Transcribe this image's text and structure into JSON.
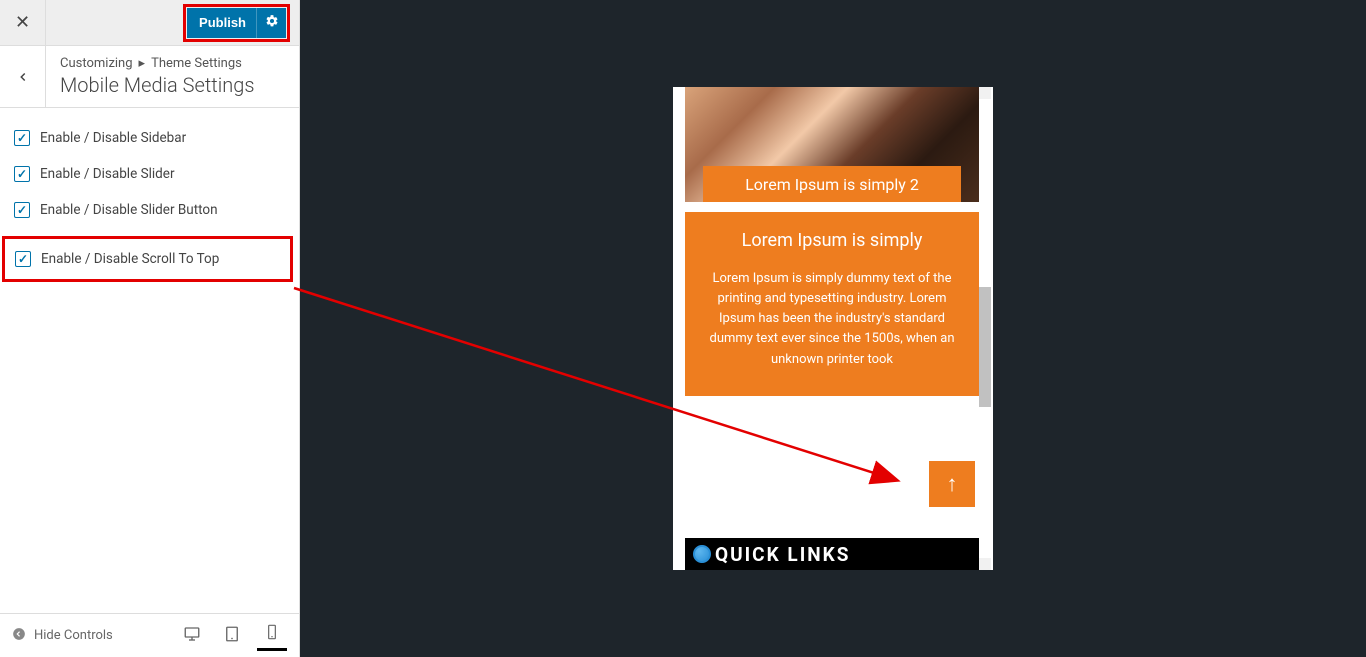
{
  "header": {
    "publish_label": "Publish"
  },
  "breadcrumb": {
    "root": "Customizing",
    "parent": "Theme Settings",
    "section_title": "Mobile Media Settings"
  },
  "options": [
    {
      "label": "Enable / Disable Sidebar",
      "checked": true
    },
    {
      "label": "Enable / Disable Slider",
      "checked": true
    },
    {
      "label": "Enable / Disable Slider Button",
      "checked": true
    },
    {
      "label": "Enable / Disable Scroll To Top",
      "checked": true,
      "highlight": true
    }
  ],
  "footer": {
    "hide_controls": "Hide Controls"
  },
  "preview": {
    "hero_caption": "Lorem Ipsum is simply 2",
    "card_title": "Lorem Ipsum is simply",
    "card_body": "Lorem Ipsum is simply dummy text of the printing and typesetting industry. Lorem Ipsum has been the industry's standard dummy text ever since the 1500s, when an unknown printer took",
    "footer_text": "QUICK LINKS"
  }
}
